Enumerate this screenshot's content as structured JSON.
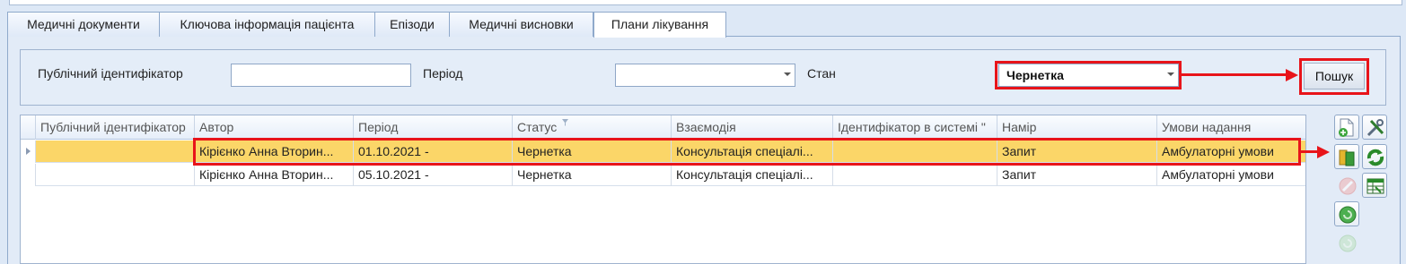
{
  "tabs": [
    {
      "label": "Медичні документи"
    },
    {
      "label": "Ключова інформація пацієнта"
    },
    {
      "label": "Епізоди"
    },
    {
      "label": "Медичні висновки"
    },
    {
      "label": "Плани лікування"
    }
  ],
  "filters": {
    "public_id_label": "Публічний ідентифікатор",
    "public_id_value": "",
    "period_label": "Період",
    "period_value": "",
    "state_label": "Стан",
    "state_value": "Чернетка",
    "search_button": "Пошук"
  },
  "table": {
    "columns": [
      "Публічний ідентифікатор",
      "Автор",
      "Період",
      "Статус",
      "Взаємодія",
      "Ідентифікатор в системі \"",
      "Намір",
      "Умови надання"
    ],
    "rows": [
      {
        "public_id": "",
        "author": "Кірієнко Анна Вторин...",
        "period": "01.10.2021 -",
        "status": "Чернетка",
        "interaction": "Консультація спеціалі...",
        "system_id": "",
        "intent": "Запит",
        "conditions": "Амбулаторні умови"
      },
      {
        "public_id": "",
        "author": "Кірієнко Анна Вторин...",
        "period": "05.10.2021 -",
        "status": "Чернетка",
        "interaction": "Консультація спеціалі...",
        "system_id": "",
        "intent": "Запит",
        "conditions": "Амбулаторні умови"
      }
    ]
  },
  "toolbar": {
    "icons": [
      "add-document-icon",
      "settings-tools-icon",
      "open-document-icon",
      "refresh-sync-icon",
      "cancel-icon",
      "table-export-icon",
      "sign-icon",
      "sign-disabled-icon"
    ]
  },
  "colors": {
    "highlight": "#e8141a",
    "selected_row": "#fbd668",
    "accent": "#2a8a2a"
  }
}
